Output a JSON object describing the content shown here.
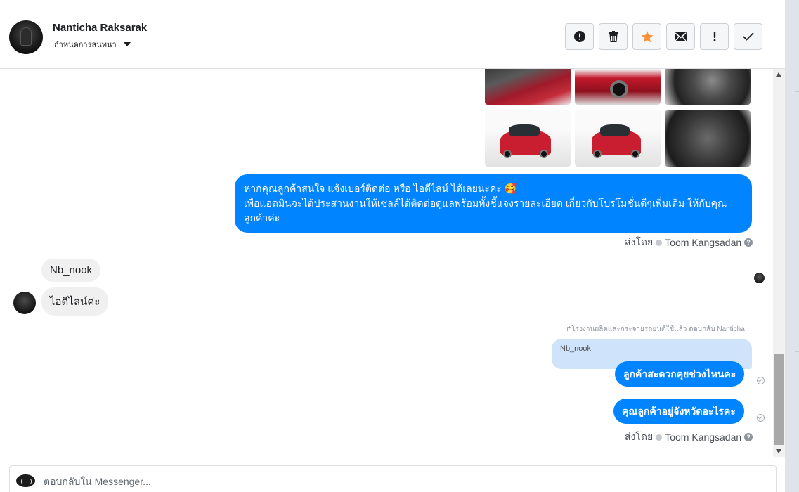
{
  "header": {
    "contact_name": "Nanticha Raksarak",
    "conversation_setting": "กำหนดการสนทนา",
    "actions": [
      {
        "icon": "alert-circle-icon",
        "name": "mark-spam-button"
      },
      {
        "icon": "trash-icon",
        "name": "delete-button"
      },
      {
        "icon": "star-icon",
        "name": "star-button",
        "color": "#f7923b"
      },
      {
        "icon": "envelope-icon",
        "name": "mark-unread-button"
      },
      {
        "icon": "exclamation-icon",
        "name": "follow-up-button"
      },
      {
        "icon": "check-icon",
        "name": "mark-done-button"
      }
    ]
  },
  "messages": {
    "outgoing_text": "หากคุณลูกค้าสนใจ แจ้งเบอร์ติดต่อ หรือ ไอดีไลน์ ได้เลยนะคะ 🥰\nเพื่อแอดมินจะได้ประสานงานให้เซลล์ได้ติดต่อดูแลพร้อมทั้งชี้แจงรายละเอียด เกี่ยวกับโปรโมชั่นดีๆเพิ่มเติม ให้กับคุณลูกค้าค่ะ",
    "sent_by_prefix": "ส่งโดย",
    "sent_by_name": "Toom Kangsadan",
    "incoming": [
      "Nb_nook",
      "ไอดีไลน์ค่ะ"
    ],
    "reply_note": "โรงงานผลิตและกระจายรถยนต์ใช้แล้ว ตอบกลับ Nanticha",
    "quoted_text": "Nb_nook",
    "reply_1": "ลูกค้าสะดวกคุยช่วงไหนคะ",
    "reply_2": "คุณลูกค้าอยู่จังหวัดอะไรคะ",
    "sent_by_prefix_2": "ส่งโดย",
    "sent_by_name_2": "Toom Kangsadan",
    "help_glyph": "?"
  },
  "composer": {
    "placeholder": "ตอบกลับใน Messenger..."
  },
  "colors": {
    "accent_blue": "#0084ff",
    "star_orange": "#f7923b"
  }
}
